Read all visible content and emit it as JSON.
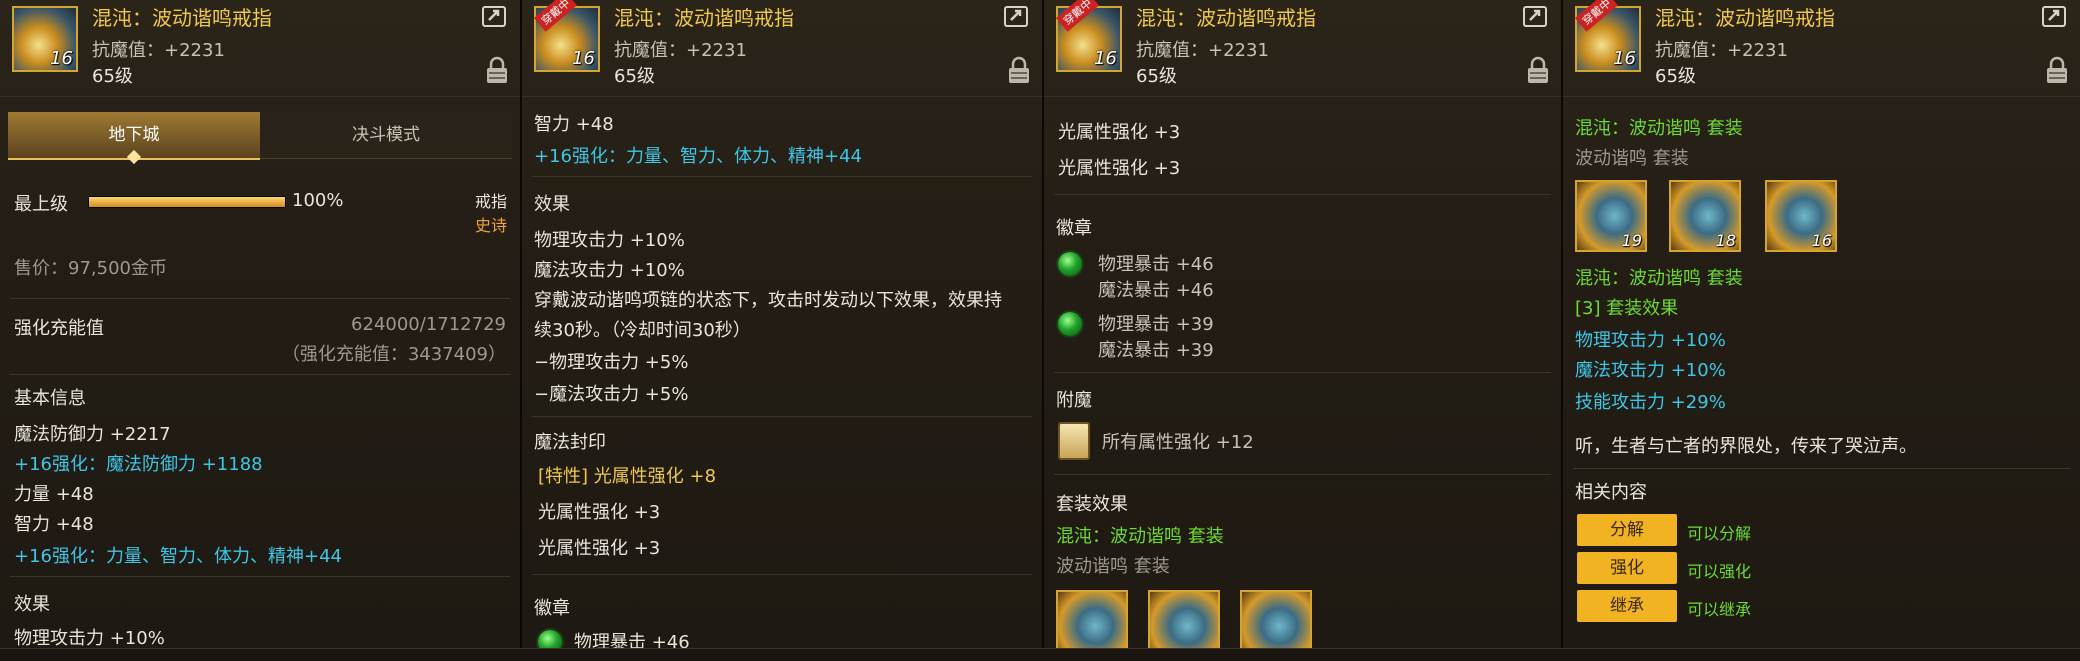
{
  "item": {
    "name": "混沌：波动谐鸣戒指",
    "stat": "抗魔值：+2231",
    "level": "65级",
    "icon_level": "16"
  },
  "panel1": {
    "tabs": [
      "地下城",
      "决斗模式"
    ],
    "grade_label": "最上级",
    "grade_percent": "100%",
    "grade_fill": 1.0,
    "slot": "戒指",
    "rarity": "史诗",
    "price": "售价：97,500金币",
    "charge_label": "强化充能值",
    "charge_value": "624000/1712729",
    "charge_total": "（强化充能值：3437409）",
    "basic_title": "基本信息",
    "basic_lines": [
      {
        "text": "魔法防御力 +2217",
        "color": "white"
      },
      {
        "text": "+16强化：魔法防御力 +1188",
        "color": "cyan"
      },
      {
        "text": "力量 +48",
        "color": "white"
      },
      {
        "text": "智力 +48",
        "color": "white"
      },
      {
        "text": "+16强化：力量、智力、体力、精神+44",
        "color": "cyan"
      }
    ],
    "effect_title": "效果",
    "effect_partial": "物理攻击力 +10%"
  },
  "panel2": {
    "top_lines": [
      {
        "text": "智力 +48",
        "color": "white"
      },
      {
        "text": "+16强化：力量、智力、体力、精神+44",
        "color": "cyan"
      }
    ],
    "effect_title": "效果",
    "effect_lines": [
      "物理攻击力 +10%",
      "魔法攻击力 +10%",
      "穿戴波动谐鸣项链的状态下，攻击时发动以下效果，效果持",
      "续30秒。（冷却时间30秒）",
      "−物理攻击力 +5%",
      "−魔法攻击力 +5%"
    ],
    "seal_title": "魔法封印",
    "seal_lines": [
      {
        "text": "[特性] 光属性强化 +8",
        "color": "yellow"
      },
      {
        "text": "光属性强化 +3",
        "color": "white"
      },
      {
        "text": "光属性强化 +3",
        "color": "white"
      }
    ],
    "emblem_title": "徽章",
    "emblem_partial": "物理暴击 +46"
  },
  "panel3": {
    "top_lines": [
      "光属性强化 +3",
      "光属性强化 +3"
    ],
    "emblem_title": "徽章",
    "emblems": [
      {
        "line1": "物理暴击 +46",
        "line2": "魔法暴击 +46"
      },
      {
        "line1": "物理暴击 +39",
        "line2": "魔法暴击 +39"
      }
    ],
    "enchant_title": "附魔",
    "enchant_text": "所有属性强化 +12",
    "set_title": "套装效果",
    "set_name": "混沌：波动谐鸣 套装",
    "set_sub": "波动谐鸣 套装",
    "set_icon_levels": [
      "",
      "",
      ""
    ]
  },
  "panel4": {
    "set_name": "混沌：波动谐鸣 套装",
    "set_sub": "波动谐鸣 套装",
    "set_icon_levels": [
      "19",
      "18",
      "16"
    ],
    "set_name2": "混沌：波动谐鸣 套装",
    "set_effect_title": "[3] 套装效果",
    "set_effects": [
      "物理攻击力 +10%",
      "魔法攻击力 +10%",
      "技能攻击力 +29%"
    ],
    "flavor": "听，生者与亡者的界限处，传来了哭泣声。",
    "related_title": "相关内容",
    "actions": [
      {
        "label": "分解",
        "desc": "可以分解"
      },
      {
        "label": "强化",
        "desc": "可以强化"
      },
      {
        "label": "继承",
        "desc": "可以继承"
      }
    ]
  },
  "ribbon_text": "穿戴中"
}
